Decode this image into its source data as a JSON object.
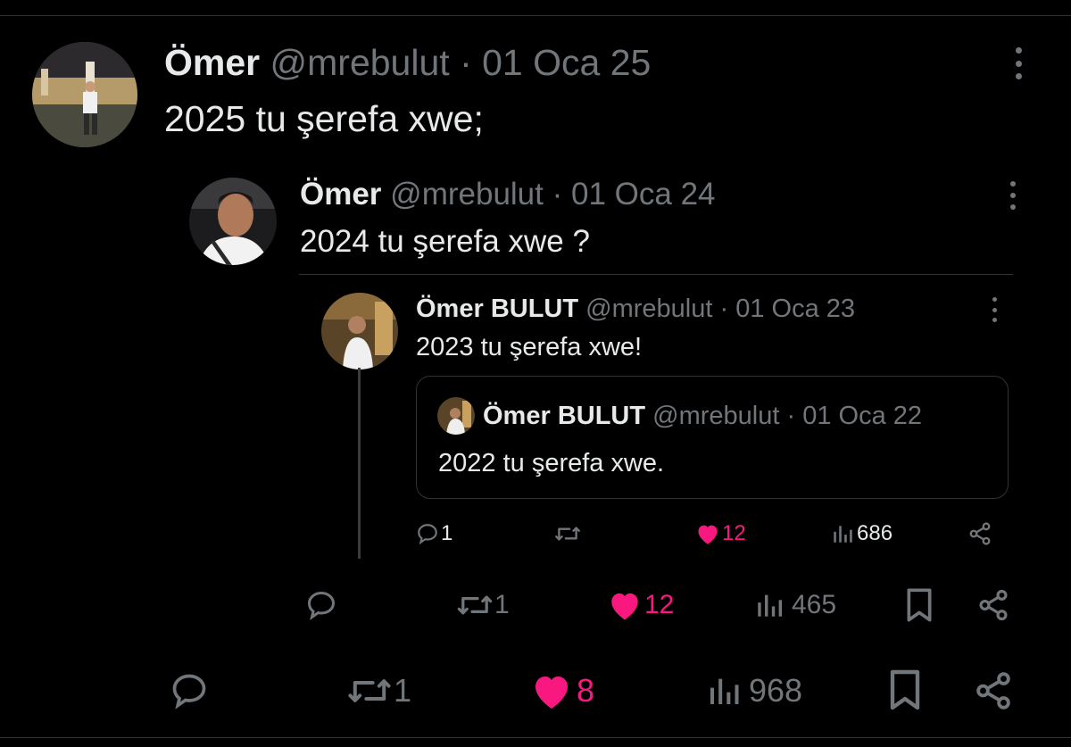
{
  "main_tweet": {
    "name": "Ömer",
    "handle": "@mrebulut",
    "sep": "·",
    "date": "01 Oca 25",
    "text": "2025 tu şerefa xwe;",
    "actions": {
      "reply": "",
      "retweet": "1",
      "like": "8",
      "views": "968"
    }
  },
  "quoted_tweet": {
    "name": "Ömer",
    "handle": "@mrebulut",
    "sep": "·",
    "date": "01 Oca 24",
    "text": "2024 tu şerefa xwe ?",
    "actions": {
      "reply": "",
      "retweet": "1",
      "like": "12",
      "views": "465"
    }
  },
  "inner_tweet": {
    "name": "Ömer BULUT",
    "handle": "@mrebulut",
    "sep": "·",
    "date": "01 Oca 23",
    "text": "2023 tu şerefa xwe!",
    "actions": {
      "reply": "1",
      "retweet": "",
      "like": "12",
      "views": "686"
    }
  },
  "innermost_quote": {
    "name": "Ömer BULUT",
    "handle": "@mrebulut",
    "sep": "·",
    "date": "01 Oca 22",
    "text": "2022 tu şerefa xwe."
  },
  "icons": {
    "reply": "reply-icon",
    "retweet": "retweet-icon",
    "like": "heart-icon",
    "views": "views-icon",
    "bookmark": "bookmark-icon",
    "share": "share-icon",
    "more": "more-icon"
  },
  "colors": {
    "background": "#000000",
    "text": "#e7e9ea",
    "muted": "#71767b",
    "like": "#f91880",
    "border": "#2f3336"
  }
}
